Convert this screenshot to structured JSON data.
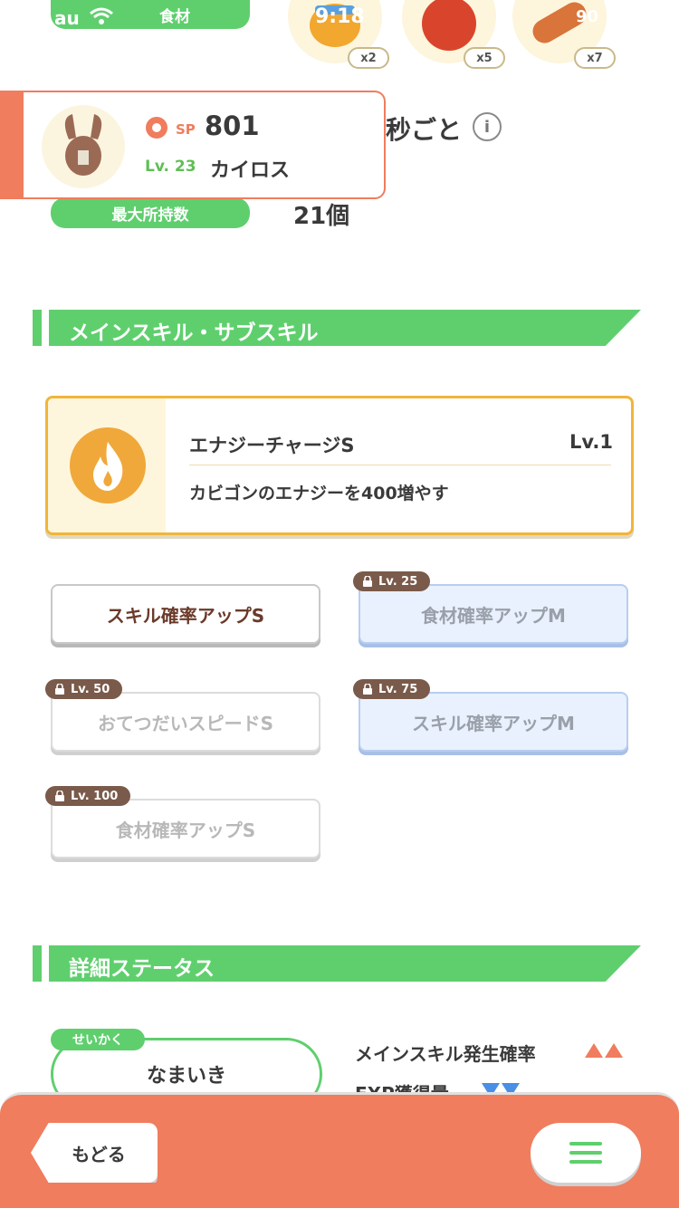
{
  "status_bar": {
    "carrier": "au",
    "time": "9:18",
    "battery": "90"
  },
  "top_ingredients": {
    "label": "食材",
    "items": [
      {
        "icon": "honey-icon",
        "count": "x2"
      },
      {
        "icon": "apple-icon",
        "count": "x5"
      },
      {
        "icon": "sausage-icon",
        "count": "x7"
      }
    ]
  },
  "pokemon": {
    "sp_label": "SP",
    "sp_value": "801",
    "level_label": "Lv. 23",
    "name": "カイロス"
  },
  "help_interval_suffix": "秒ごと",
  "max_carry": {
    "label": "最大所持数",
    "value": "21個"
  },
  "skills_section": {
    "title": "メインスキル・サブスキル"
  },
  "main_skill": {
    "name": "エナジーチャージS",
    "level": "Lv.1",
    "description": "カビゴンのエナジーを400増やす",
    "icon": "flame-icon",
    "color": "#f0a83a"
  },
  "sub_skills": [
    {
      "label": "スキル確率アップS",
      "lock": ""
    },
    {
      "label": "食材確率アップM",
      "lock": "Lv. 25"
    },
    {
      "label": "おてつだいスピードS",
      "lock": "Lv. 50"
    },
    {
      "label": "スキル確率アップM",
      "lock": "Lv. 75"
    },
    {
      "label": "食材確率アップS",
      "lock": "Lv. 100"
    }
  ],
  "details_section": {
    "title": "詳細ステータス"
  },
  "nature": {
    "tag": "せいかく",
    "value": "なまいき"
  },
  "nature_effects": [
    {
      "label": "メインスキル発生確率",
      "direction": "up"
    },
    {
      "label": "EXP獲得量",
      "direction": "down"
    }
  ],
  "bottom_bar": {
    "back_label": "もどる",
    "menu_icon": "hamburger-icon"
  },
  "colors": {
    "accent_green": "#5fcf6e",
    "accent_orange": "#ef7d5e",
    "gold": "#f0b53b"
  }
}
